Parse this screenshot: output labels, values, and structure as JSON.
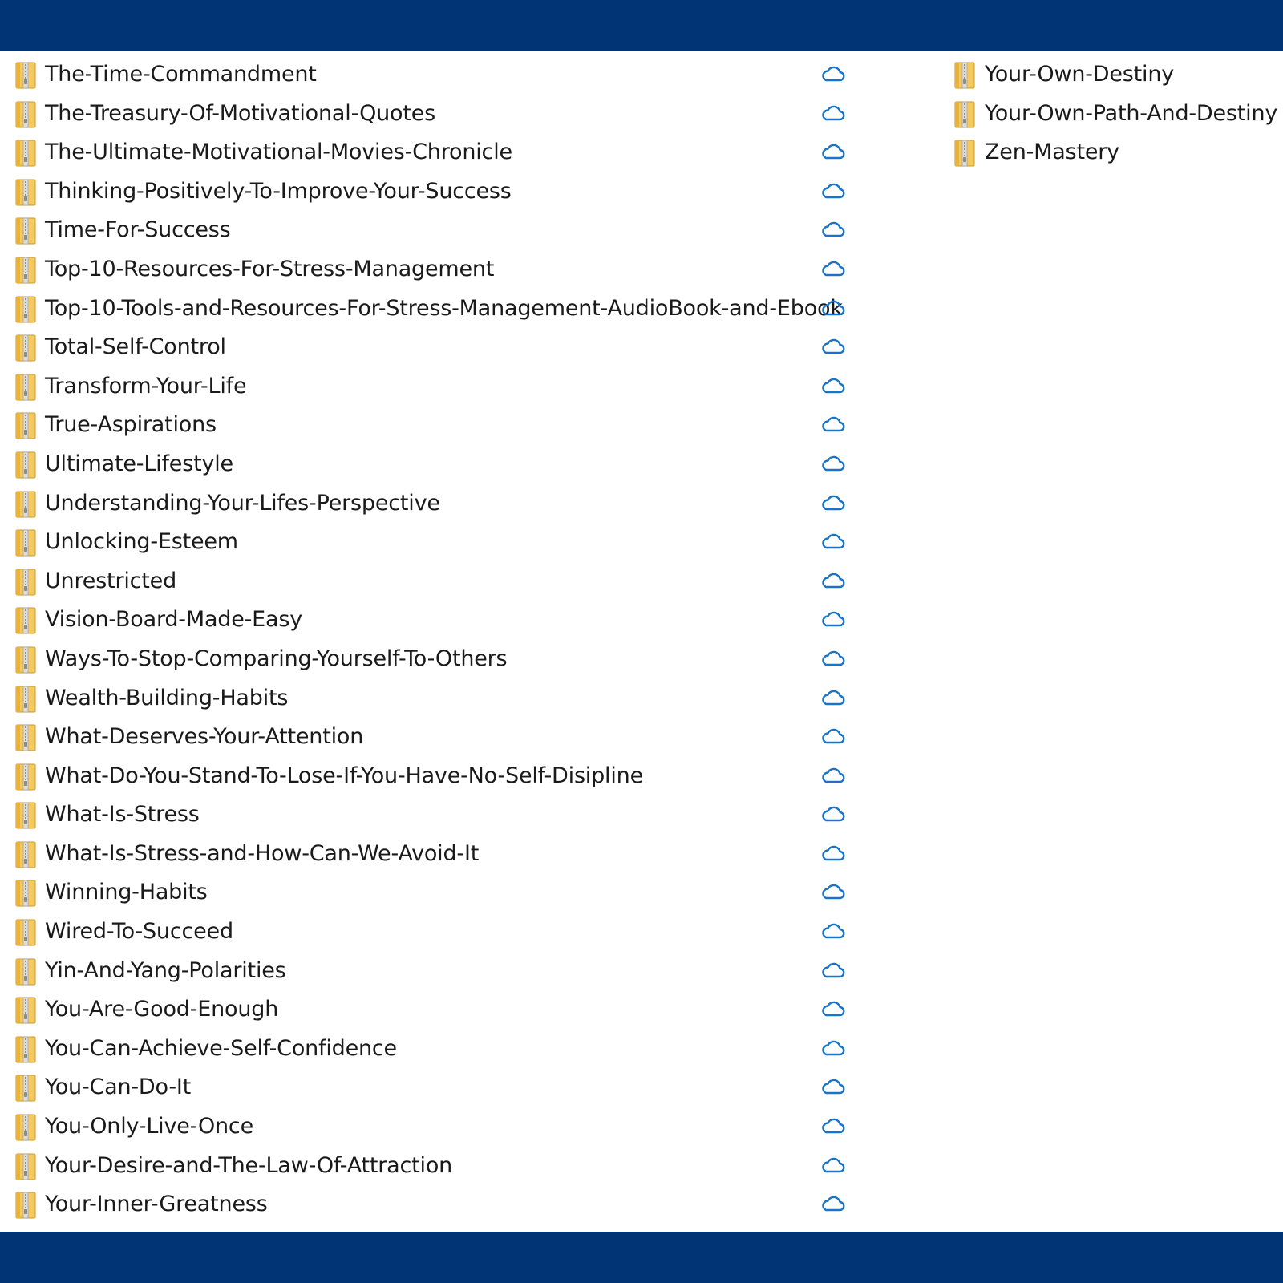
{
  "colors": {
    "background": "#013474",
    "panel": "#ffffff",
    "cloud": "#1a73c6"
  },
  "icons": {
    "file": "zip-folder-icon",
    "status": "cloud-icon"
  },
  "files_left": [
    {
      "name": "The-Time-Commandment"
    },
    {
      "name": "The-Treasury-Of-Motivational-Quotes"
    },
    {
      "name": "The-Ultimate-Motivational-Movies-Chronicle"
    },
    {
      "name": "Thinking-Positively-To-Improve-Your-Success"
    },
    {
      "name": "Time-For-Success"
    },
    {
      "name": "Top-10-Resources-For-Stress-Management"
    },
    {
      "name": "Top-10-Tools-and-Resources-For-Stress-Management-AudioBook-and-Ebook"
    },
    {
      "name": "Total-Self-Control"
    },
    {
      "name": "Transform-Your-Life"
    },
    {
      "name": "True-Aspirations"
    },
    {
      "name": "Ultimate-Lifestyle"
    },
    {
      "name": "Understanding-Your-Lifes-Perspective"
    },
    {
      "name": "Unlocking-Esteem"
    },
    {
      "name": "Unrestricted"
    },
    {
      "name": "Vision-Board-Made-Easy"
    },
    {
      "name": "Ways-To-Stop-Comparing-Yourself-To-Others"
    },
    {
      "name": "Wealth-Building-Habits"
    },
    {
      "name": "What-Deserves-Your-Attention"
    },
    {
      "name": "What-Do-You-Stand-To-Lose-If-You-Have-No-Self-Disipline"
    },
    {
      "name": "What-Is-Stress"
    },
    {
      "name": "What-Is-Stress-and-How-Can-We-Avoid-It"
    },
    {
      "name": "Winning-Habits"
    },
    {
      "name": "Wired-To-Succeed"
    },
    {
      "name": "Yin-And-Yang-Polarities"
    },
    {
      "name": "You-Are-Good-Enough"
    },
    {
      "name": "You-Can-Achieve-Self-Confidence"
    },
    {
      "name": "You-Can-Do-It"
    },
    {
      "name": "You-Only-Live-Once"
    },
    {
      "name": "Your-Desire-and-The-Law-Of-Attraction"
    },
    {
      "name": "Your-Inner-Greatness"
    }
  ],
  "files_right": [
    {
      "name": "Your-Own-Destiny"
    },
    {
      "name": "Your-Own-Path-And-Destiny"
    },
    {
      "name": "Zen-Mastery"
    }
  ]
}
